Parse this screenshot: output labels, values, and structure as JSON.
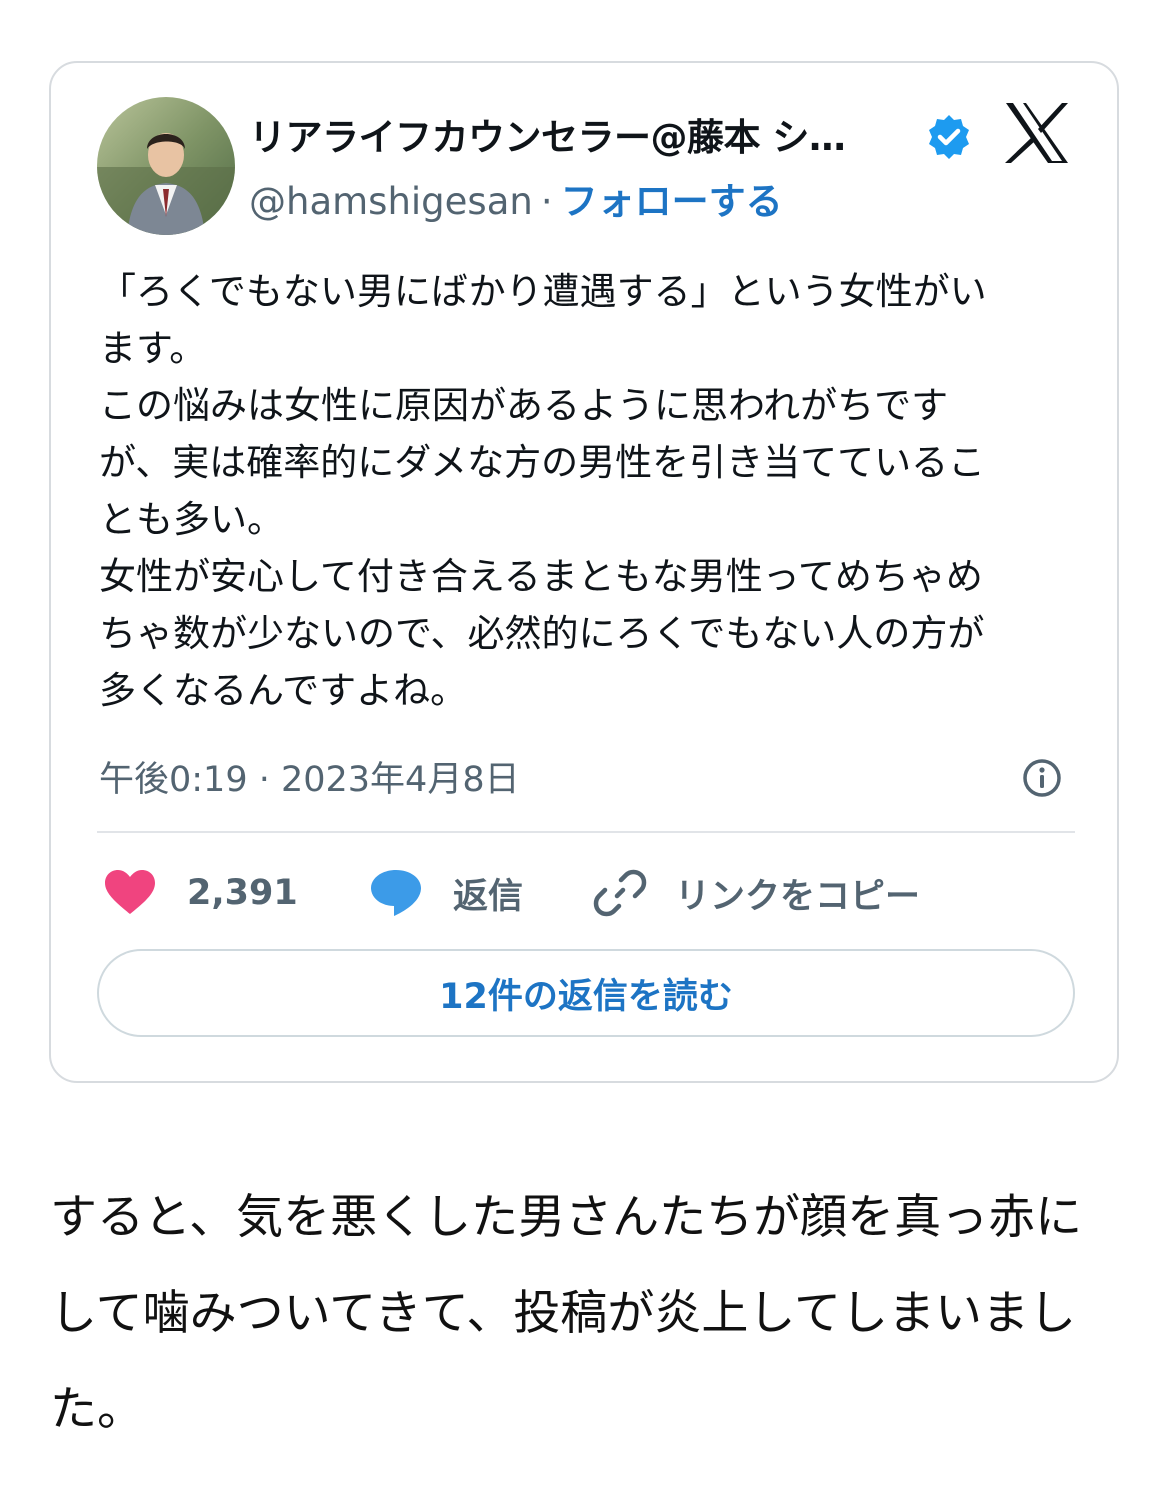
{
  "tweet": {
    "author_name": "リアライフカウンセラー@藤本 シ…",
    "handle": "@hamshigesan",
    "separator": "·",
    "follow_label": "フォローする",
    "text_lines": [
      "「ろくでもない男にばかり遭遇する」という女性がい",
      "ます。",
      "この悩みは女性に原因があるように思われがちです",
      "が、実は確率的にダメな方の男性を引き当てているこ",
      "とも多い。",
      "女性が安心して付き合えるまともな男性ってめちゃめ",
      "ちゃ数が少ないので、必然的にろくでもない人の方が",
      "多くなるんですよね。"
    ],
    "timestamp": "午後0:19 · 2023年4月8日",
    "like_count": "2,391",
    "reply_label": "返信",
    "copy_link_label": "リンクをコピー",
    "read_replies_label": "12件の返信を読む",
    "icons": {
      "verified": "verified-badge-icon",
      "logo": "x-logo-icon",
      "info": "info-icon",
      "like": "heart-icon",
      "reply": "speech-bubble-icon",
      "link": "link-icon"
    },
    "colors": {
      "accent": "#1d74c4",
      "heart": "#f0447f",
      "reply_bubble": "#3c9be8",
      "muted": "#536471"
    }
  },
  "article": {
    "lines": [
      "すると、気を悪くした男さんたちが顔を真っ赤に",
      "して噛みついてきて、投稿が炎上してしまいまし",
      "た。"
    ]
  }
}
